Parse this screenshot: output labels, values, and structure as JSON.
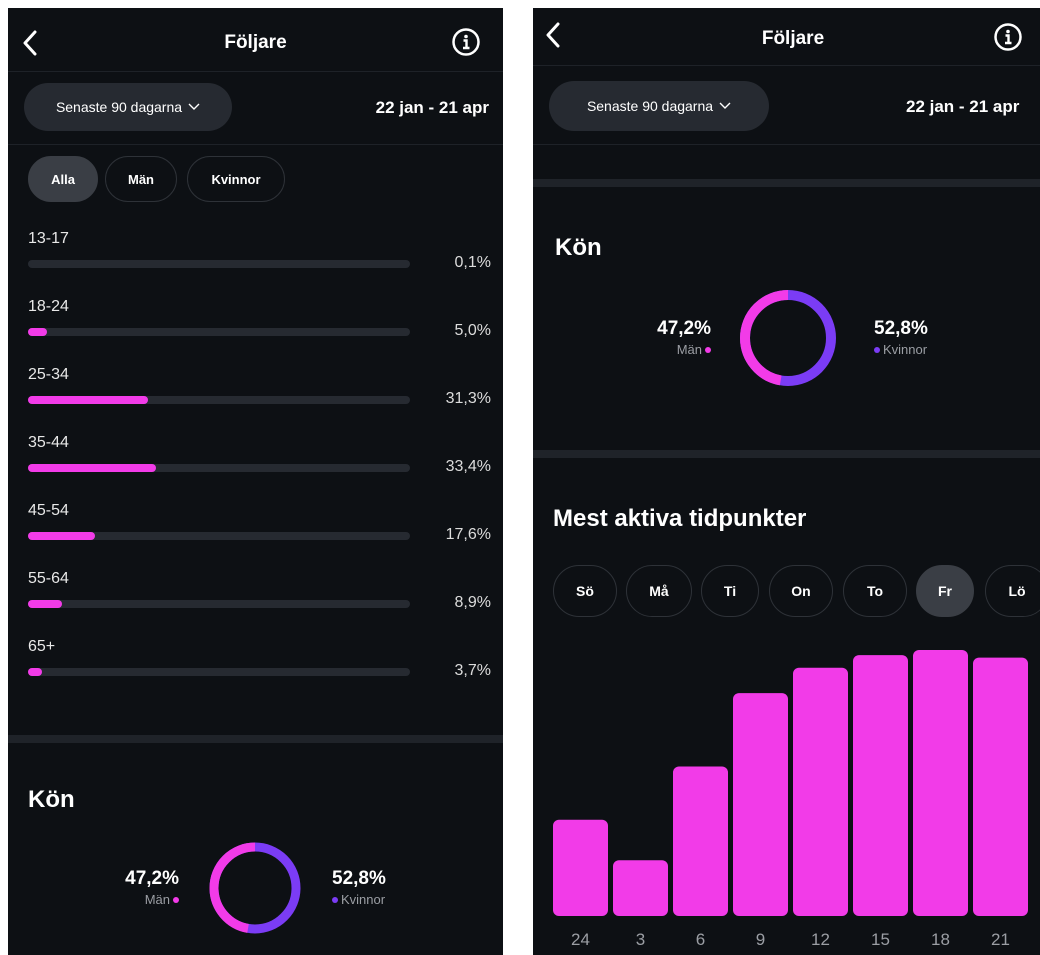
{
  "header": {
    "title": "Följare",
    "back_icon": "chevron-left-icon",
    "info_icon": "info-icon"
  },
  "filter": {
    "period_label": "Senaste 90 dagarna",
    "date_range": "22 jan - 21 apr"
  },
  "gender_tabs": [
    {
      "label": "Alla",
      "active": true
    },
    {
      "label": "Män",
      "active": false
    },
    {
      "label": "Kvinnor",
      "active": false
    }
  ],
  "age_groups": [
    {
      "label": "13-17",
      "value": "0,1%",
      "fraction": 0.001
    },
    {
      "label": "18-24",
      "value": "5,0%",
      "fraction": 0.05
    },
    {
      "label": "25-34",
      "value": "31,3%",
      "fraction": 0.313
    },
    {
      "label": "35-44",
      "value": "33,4%",
      "fraction": 0.334
    },
    {
      "label": "45-54",
      "value": "17,6%",
      "fraction": 0.176
    },
    {
      "label": "55-64",
      "value": "8,9%",
      "fraction": 0.089
    },
    {
      "label": "65+",
      "value": "3,7%",
      "fraction": 0.037
    }
  ],
  "gender": {
    "title": "Kön",
    "men": {
      "value": "47,2%",
      "label": "Män",
      "fraction": 0.472,
      "color": "#f23be8"
    },
    "women": {
      "value": "52,8%",
      "label": "Kvinnor",
      "fraction": 0.528,
      "color": "#7b3cf5"
    }
  },
  "active_times": {
    "title": "Mest aktiva tidpunkter",
    "days": [
      {
        "label": "Sö",
        "active": false
      },
      {
        "label": "Må",
        "active": false
      },
      {
        "label": "Ti",
        "active": false
      },
      {
        "label": "On",
        "active": false
      },
      {
        "label": "To",
        "active": false
      },
      {
        "label": "Fr",
        "active": true
      },
      {
        "label": "Lö",
        "active": false
      }
    ]
  },
  "colors": {
    "accent_pink": "#f23be8",
    "accent_purple": "#7b3cf5",
    "background": "#0d1014"
  },
  "chart_data": {
    "type": "bar",
    "categories": [
      "24",
      "3",
      "6",
      "9",
      "12",
      "15",
      "18",
      "21"
    ],
    "values": [
      38,
      22,
      59,
      88,
      98,
      103,
      105,
      102
    ],
    "ylim": [
      0,
      105
    ],
    "grid": false,
    "title": "",
    "xlabel": "",
    "ylabel": ""
  }
}
